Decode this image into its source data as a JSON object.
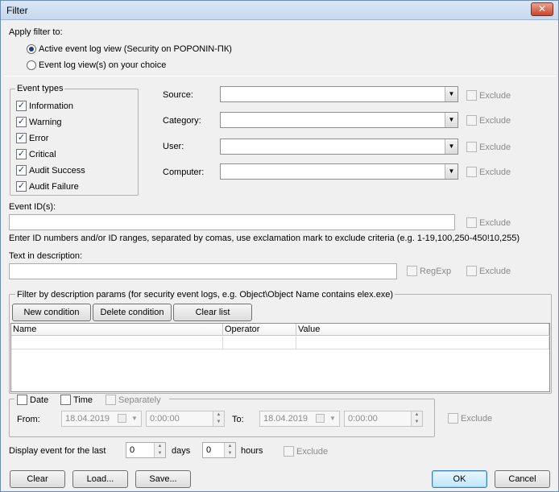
{
  "window": {
    "title": "Filter",
    "close_glyph": "✕"
  },
  "apply_filter": {
    "label": "Apply filter to:",
    "option_active": "Active event log view (Security on POPONIN-ПК)",
    "option_choice": "Event log view(s) on your choice",
    "selected": "active"
  },
  "event_types": {
    "title": "Event types",
    "items": [
      {
        "label": "Information",
        "checked": true
      },
      {
        "label": "Warning",
        "checked": true
      },
      {
        "label": "Error",
        "checked": true
      },
      {
        "label": "Critical",
        "checked": true
      },
      {
        "label": "Audit Success",
        "checked": true
      },
      {
        "label": "Audit Failure",
        "checked": true
      }
    ]
  },
  "fields": {
    "source_label": "Source:",
    "category_label": "Category:",
    "user_label": "User:",
    "computer_label": "Computer:",
    "exclude_label": "Exclude"
  },
  "event_id": {
    "label": "Event ID(s):",
    "value": "",
    "hint": "Enter ID numbers and/or ID ranges, separated by comas, use exclamation mark to exclude criteria (e.g. 1-19,100,250-450!10,255)"
  },
  "description": {
    "label": "Text in description:",
    "value": "",
    "regexp_label": "RegExp"
  },
  "params": {
    "title": "Filter by description params (for security event logs, e.g. Object\\Object Name contains elex.exe)",
    "new_condition": "New condition",
    "delete_condition": "Delete condition",
    "clear_list": "Clear list",
    "columns": [
      "Name",
      "Operator",
      "Value"
    ]
  },
  "datetime": {
    "date_label": "Date",
    "time_label": "Time",
    "separately_label": "Separately",
    "from_label": "From:",
    "to_label": "To:",
    "from_date": "18.04.2019",
    "from_time": "0:00:00",
    "to_date": "18.04.2019",
    "to_time": "0:00:00"
  },
  "last": {
    "label": "Display event for the last",
    "days_value": "0",
    "days_label": "days",
    "hours_value": "0",
    "hours_label": "hours"
  },
  "buttons": {
    "clear": "Clear",
    "load": "Load...",
    "save": "Save...",
    "ok": "OK",
    "cancel": "Cancel"
  },
  "icons": {
    "check": "✓",
    "down_arrow": "▼",
    "spin_up": "▲",
    "spin_down": "▼"
  }
}
